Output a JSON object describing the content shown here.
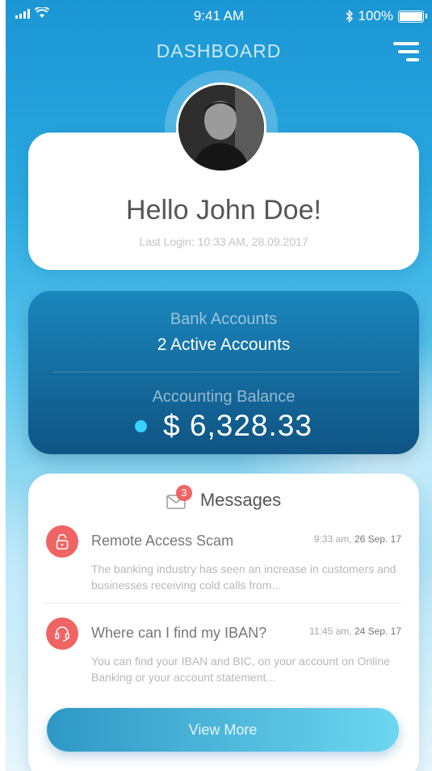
{
  "status_bar": {
    "time": "9:41 AM",
    "battery": "100%"
  },
  "header": {
    "title": "DASHBOARD"
  },
  "greeting": {
    "hello": "Hello John Doe!",
    "last_login": "Last Login: 10:33 AM, 28.09.2017"
  },
  "accounts": {
    "label": "Bank Accounts",
    "value": "2 Active Accounts",
    "balance_label": "Accounting Balance",
    "balance_value": "$ 6,328.33"
  },
  "messages": {
    "title": "Messages",
    "unread_count": "3",
    "items": [
      {
        "subject": "Remote Access Scam",
        "time": "9:33 am,",
        "date": "26 Sep. 17",
        "preview": "The banking industry has seen an increase in customers and businesses receiving cold calls from...",
        "icon": "lock-icon"
      },
      {
        "subject": "Where can I find my IBAN?",
        "time": "11:45 am,",
        "date": "24 Sep. 17",
        "preview": "You can find your IBAN and BIC, on your account on Online Banking or your account statement...",
        "icon": "headset-icon"
      }
    ],
    "view_more": "View More"
  },
  "colors": {
    "accent_red": "#f06464",
    "card_blue": "#146a9c",
    "dot_blue": "#39d2ff"
  }
}
